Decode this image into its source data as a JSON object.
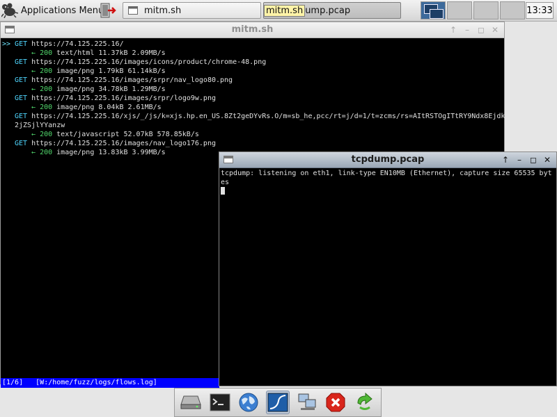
{
  "panel": {
    "apps_menu_label": "Applications Menu",
    "tasks": [
      {
        "label": "mitm.sh"
      },
      {
        "label_highlight": "mitm.sh",
        "label_rest": "ump.pcap"
      }
    ],
    "clock": "13:33"
  },
  "mitm_window": {
    "title": "mitm.sh",
    "controls": [
      "↑",
      "–",
      "◻",
      "✕"
    ],
    "lines": [
      {
        "type": "request",
        "marker": ">>",
        "method": "GET",
        "url": "https://74.125.225.16/"
      },
      {
        "type": "response",
        "arrow": "←",
        "code": "200",
        "rest": "text/html 11.37kB 2.09MB/s"
      },
      {
        "type": "request",
        "marker": "",
        "method": "GET",
        "url": "https://74.125.225.16/images/icons/product/chrome-48.png"
      },
      {
        "type": "response",
        "arrow": "←",
        "code": "200",
        "rest": "image/png 1.79kB 61.14kB/s"
      },
      {
        "type": "request",
        "marker": "",
        "method": "GET",
        "url": "https://74.125.225.16/images/srpr/nav_logo80.png"
      },
      {
        "type": "response",
        "arrow": "←",
        "code": "200",
        "rest": "image/png 34.78kB 1.29MB/s"
      },
      {
        "type": "request",
        "marker": "",
        "method": "GET",
        "url": "https://74.125.225.16/images/srpr/logo9w.png"
      },
      {
        "type": "response",
        "arrow": "←",
        "code": "200",
        "rest": "image/png 8.04kB 2.61MB/s"
      },
      {
        "type": "request",
        "marker": "",
        "method": "GET",
        "url": "https://74.125.225.16/xjs/_/js/k=xjs.hp.en_US.8Zt2geDYvRs.O/m=sb_he,pcc/rt=j/d=1/t=zcms/rs=AItRSTOgITtRY9Ndx8Ejdk"
      },
      {
        "type": "continuation",
        "text": "2jZSjlYYanzw"
      },
      {
        "type": "response",
        "arrow": "←",
        "code": "200",
        "rest": "text/javascript 52.07kB 578.85kB/s"
      },
      {
        "type": "request",
        "marker": "",
        "method": "GET",
        "url": "https://74.125.225.16/images/nav_logo176.png"
      },
      {
        "type": "response",
        "arrow": "←",
        "code": "200",
        "rest": "image/png 13.83kB 3.99MB/s"
      }
    ],
    "status": "[1/6]   [W:/home/fuzz/logs/flows.log]"
  },
  "tcpdump_window": {
    "title": "tcpdump.pcap",
    "controls": [
      "↑",
      "–",
      "◻",
      "✕"
    ],
    "output": "tcpdump: listening on eth1, link-type EN10MB (Ethernet), capture size 65535 bytes"
  },
  "dock": {
    "items": [
      "drive-icon",
      "terminal-icon",
      "globe-icon",
      "wireshark-icon",
      "network-icon",
      "close-icon",
      "refresh-icon"
    ]
  }
}
